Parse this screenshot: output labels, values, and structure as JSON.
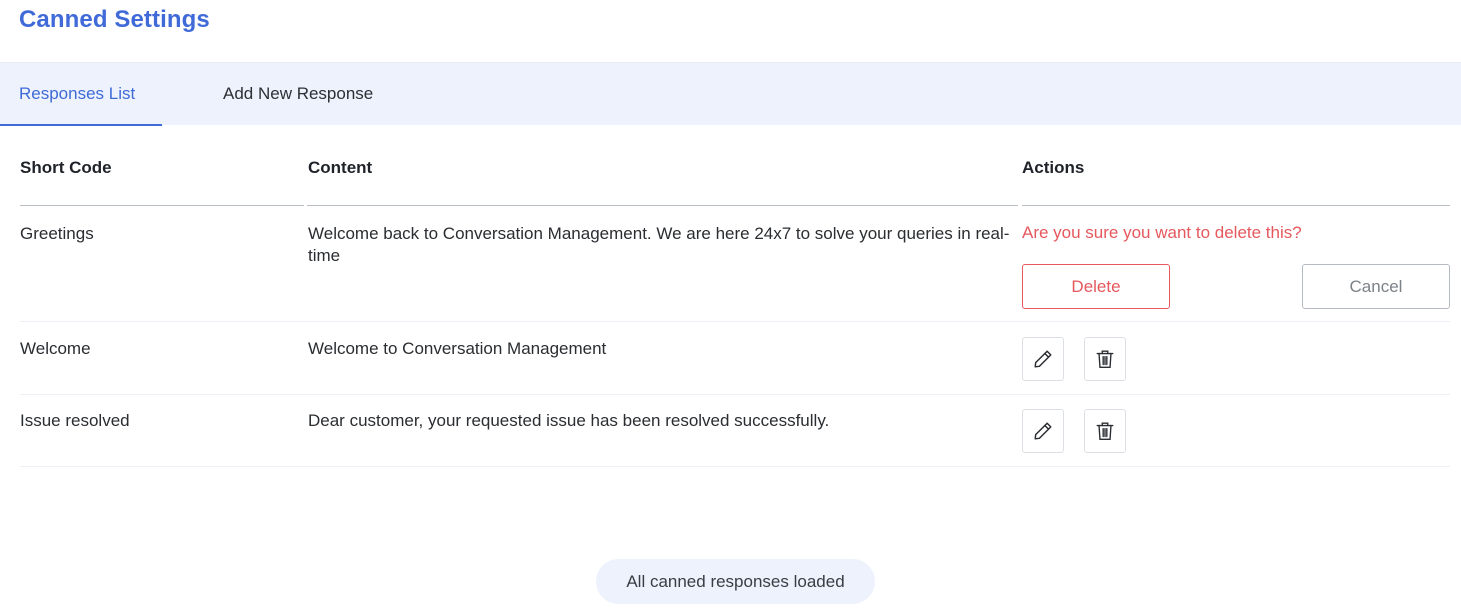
{
  "page": {
    "title": "Canned Settings"
  },
  "tabs": [
    {
      "label": "Responses List",
      "active": true
    },
    {
      "label": "Add New Response",
      "active": false
    }
  ],
  "table": {
    "columns": [
      "Short Code",
      "Content",
      "Actions"
    ],
    "rows": [
      {
        "short_code": "Greetings",
        "content_line1": "Welcome back to Conversation Management. We are here 24x7 to solve your queries in real-",
        "content_line2": "time",
        "confirm": {
          "message": "Are you sure you want to delete this?",
          "delete_label": "Delete",
          "cancel_label": "Cancel"
        }
      },
      {
        "short_code": "Welcome",
        "content": "Welcome to Conversation Management",
        "actions": [
          "edit-icon",
          "trash-icon"
        ]
      },
      {
        "short_code": "Issue resolved",
        "content": "Dear customer, your requested issue has been resolved successfully.",
        "actions": [
          "edit-icon",
          "trash-icon"
        ]
      }
    ]
  },
  "status": {
    "text": "All canned responses loaded"
  },
  "colors": {
    "accent": "#3f6ad8",
    "danger": "#e5585d",
    "tab_bg": "#edf2fc"
  }
}
